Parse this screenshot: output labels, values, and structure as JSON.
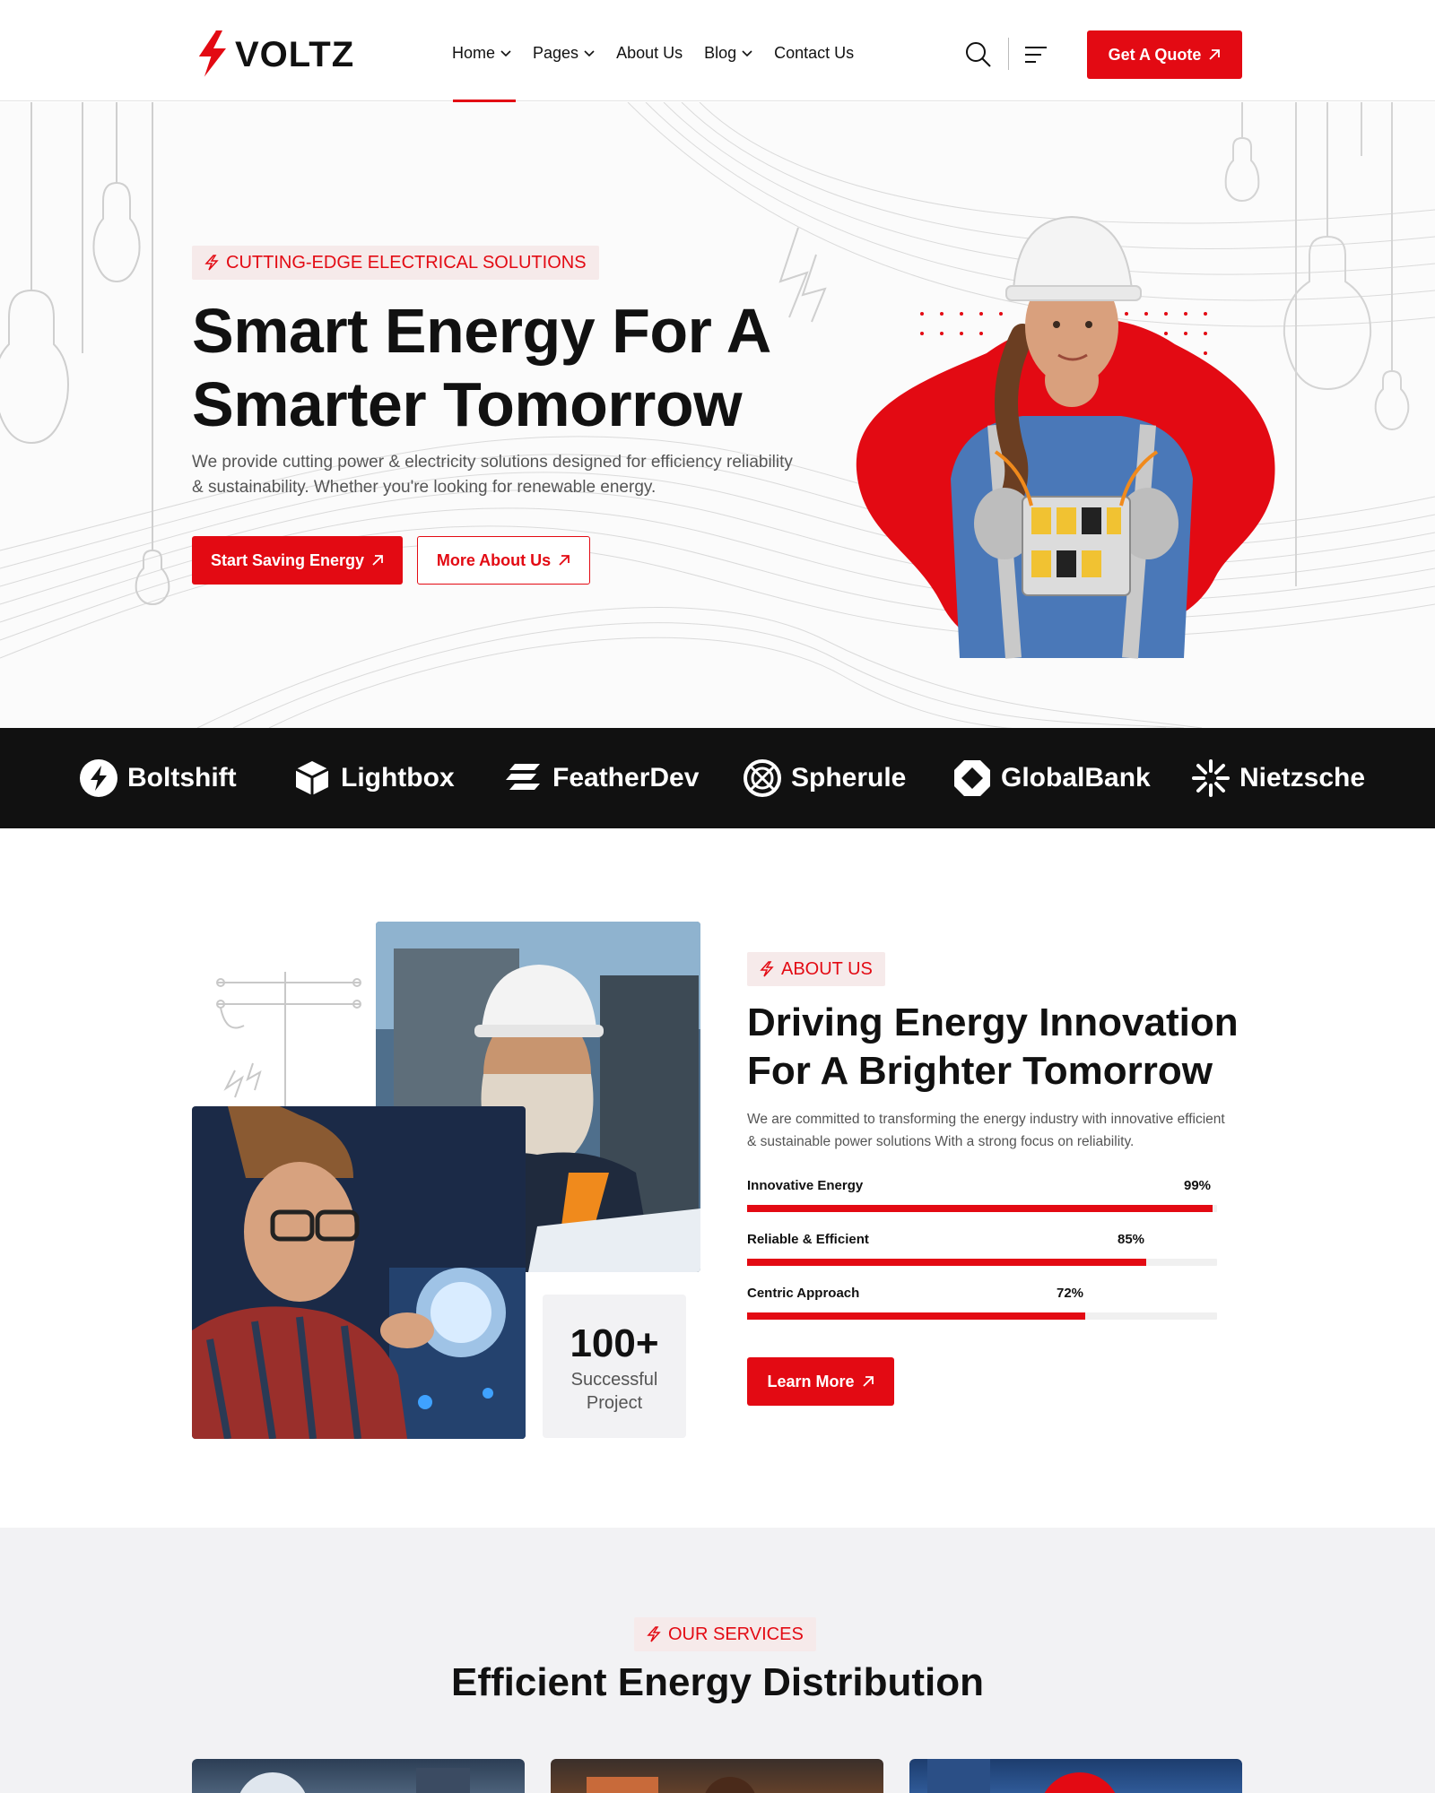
{
  "header": {
    "logo_text": "VOLTZ",
    "nav": [
      {
        "label": "Home",
        "has_dropdown": true,
        "active": true
      },
      {
        "label": "Pages",
        "has_dropdown": true
      },
      {
        "label": "About Us",
        "has_dropdown": false
      },
      {
        "label": "Blog",
        "has_dropdown": true
      },
      {
        "label": "Contact Us",
        "has_dropdown": false
      }
    ],
    "quote_button": "Get A Quote"
  },
  "hero": {
    "tag": "CUTTING-EDGE ELECTRICAL SOLUTIONS",
    "title_line1": "Smart Energy For A",
    "title_line2": "Smarter Tomorrow",
    "description": "We provide cutting power & electricity solutions designed for efficiency reliability & sustainability. Whether you're looking for renewable energy.",
    "primary_button": "Start Saving Energy",
    "secondary_button": "More About Us"
  },
  "brands": [
    "Boltshift",
    "Lightbox",
    "FeatherDev",
    "Spherule",
    "GlobalBank",
    "Nietzsche"
  ],
  "about": {
    "stat_number": "100+",
    "stat_label_line1": "Successful",
    "stat_label_line2": "Project",
    "tag": "ABOUT US",
    "title_line1": "Driving Energy Innovation",
    "title_line2": "For A Brighter Tomorrow",
    "description": "We are committed to transforming the energy industry with innovative efficient & sustainable power solutions With a strong focus on reliability.",
    "skills": [
      {
        "label": "Innovative Energy",
        "value": 99,
        "value_text": "99%"
      },
      {
        "label": "Reliable & Efficient",
        "value": 85,
        "value_text": "85%"
      },
      {
        "label": "Centric Approach",
        "value": 72,
        "value_text": "72%"
      }
    ],
    "button": "Learn More"
  },
  "services": {
    "tag": "OUR SERVICES",
    "title": "Efficient Energy Distribution"
  },
  "colors": {
    "accent": "#e30a13",
    "dark": "#111111",
    "tag_bg": "#f6eaea",
    "section_bg": "#f2f2f4"
  }
}
